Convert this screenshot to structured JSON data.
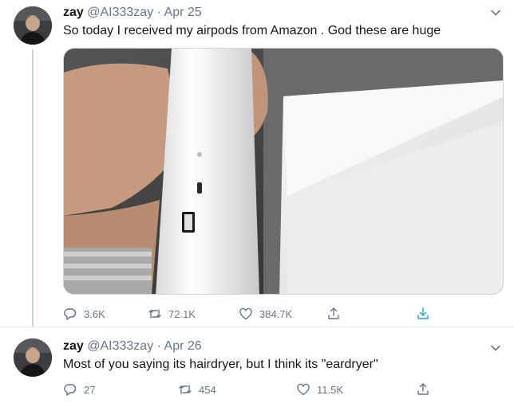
{
  "tweets": [
    {
      "name": "zay",
      "handle": "@AI333zay",
      "separator": "·",
      "date": "Apr 25",
      "text": "So today I received my airpods from Amazon . God these are huge",
      "actions": {
        "replies": "3.6K",
        "retweets": "72.1K",
        "likes": "384.7K"
      },
      "icons": [
        "reply-icon",
        "retweet-icon",
        "like-icon",
        "share-icon",
        "download-icon"
      ]
    },
    {
      "name": "zay",
      "handle": "@AI333zay",
      "separator": "·",
      "date": "Apr 26",
      "text": "Most of you saying its hairdryer,  but I think its \"eardryer\"",
      "actions": {
        "replies": "27",
        "retweets": "454",
        "likes": "11.5K"
      },
      "icons": [
        "reply-icon",
        "retweet-icon",
        "like-icon",
        "share-icon"
      ]
    }
  ],
  "colors": {
    "muted": "#657786",
    "text": "#14171a",
    "border": "#e6ecf0"
  }
}
